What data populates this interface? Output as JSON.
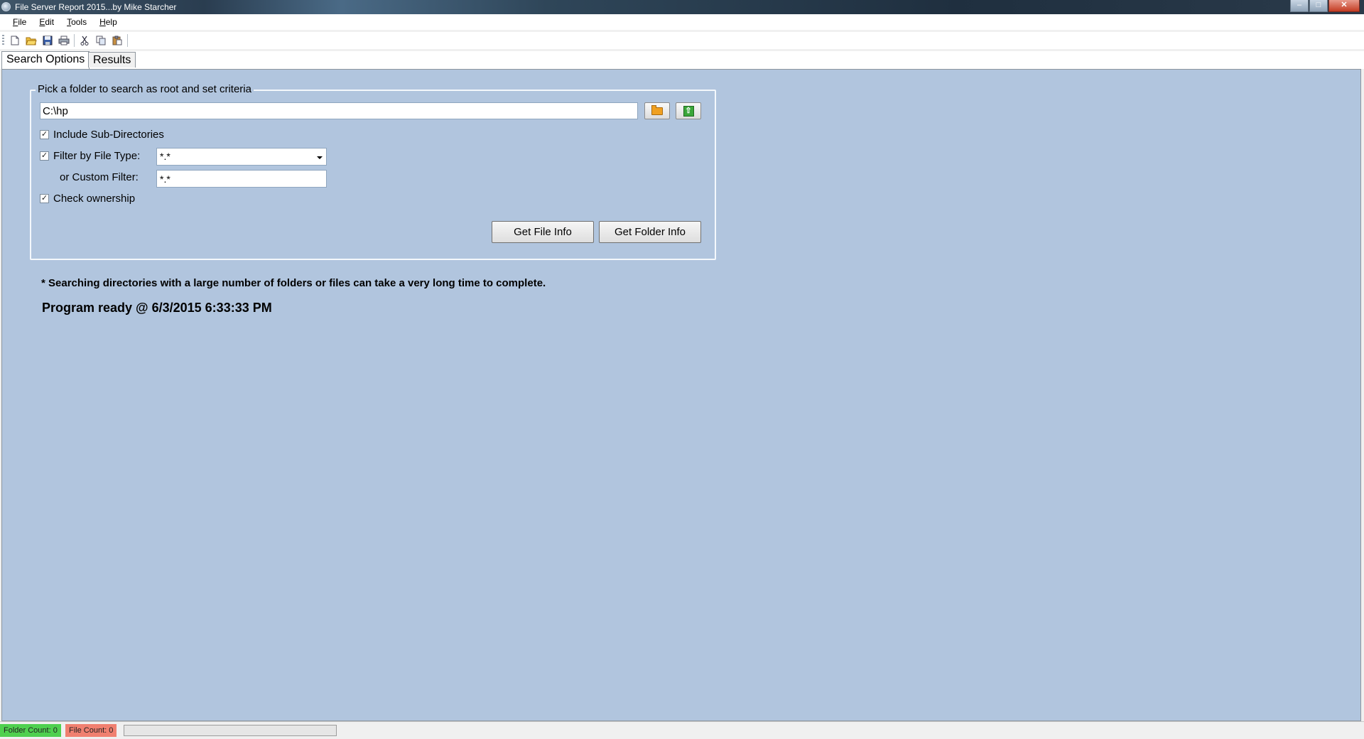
{
  "window": {
    "title": "File Server Report 2015...by Mike Starcher",
    "icon": "app-icon"
  },
  "menu": [
    {
      "label": "File",
      "mnemonic": "F",
      "rest": "ile"
    },
    {
      "label": "Edit",
      "mnemonic": "E",
      "rest": "dit"
    },
    {
      "label": "Tools",
      "mnemonic": "T",
      "rest": "ools"
    },
    {
      "label": "Help",
      "mnemonic": "H",
      "rest": "elp"
    }
  ],
  "toolbar": {
    "icons": [
      "new-file-icon",
      "open-folder-icon",
      "save-icon",
      "print-icon",
      "cut-icon",
      "copy-icon",
      "paste-icon"
    ]
  },
  "tabs": [
    {
      "label": "Search Options",
      "active": true
    },
    {
      "label": "Results",
      "active": false
    }
  ],
  "search": {
    "group_title": "Pick a folder to search as root and set criteria",
    "path_value": "C:\\hp",
    "include_subdirs": {
      "label": "Include Sub-Directories",
      "checked": true
    },
    "filter_type": {
      "label": "Filter by File Type:",
      "checked": true,
      "selected": "*.*"
    },
    "custom_filter": {
      "label": "or Custom Filter:",
      "value": "*.*"
    },
    "check_ownership": {
      "label": "Check ownership",
      "checked": true
    },
    "get_file_info": "Get File Info",
    "get_folder_info": "Get Folder Info"
  },
  "note": "* Searching directories with a large number of folders or files can take a very long time to complete.",
  "status_message": "Program ready @ 6/3/2015 6:33:33 PM",
  "statusbar": {
    "folder_count": "Folder Count: 0",
    "file_count": "File Count: 0",
    "progress": 0
  },
  "colors": {
    "panel": "#b1c5de",
    "folder_badge": "#4fd04f",
    "file_badge": "#f08070"
  }
}
